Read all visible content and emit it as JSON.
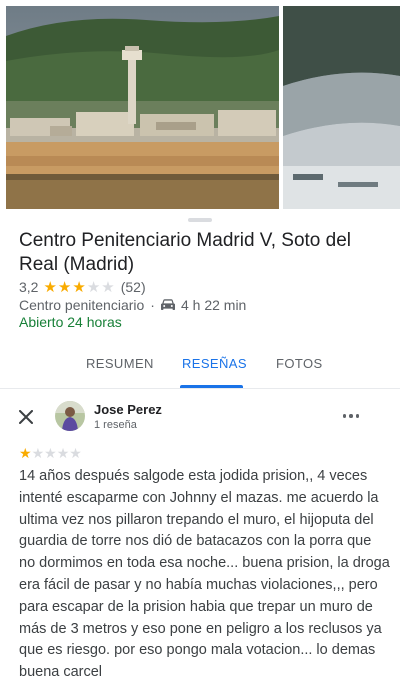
{
  "place": {
    "name": "Centro Penitenciario Madrid V, Soto del Real (Madrid)",
    "rating": "3,2",
    "rating_value": 3.2,
    "stars_filled": 3,
    "stars_total": 5,
    "review_count": "(52)",
    "category": "Centro penitenciario",
    "separator": "·",
    "drive_time": "4 h 22 min",
    "hours": "Abierto 24 horas"
  },
  "tabs": [
    {
      "label": "RESUMEN",
      "active": false
    },
    {
      "label": "RESEÑAS",
      "active": true
    },
    {
      "label": "FOTOS",
      "active": false
    }
  ],
  "review": {
    "author": "Jose Perez",
    "author_reviews": "1 reseña",
    "stars_filled": 1,
    "stars_total": 5,
    "text": "14 años después salgode esta jodida prision,, 4 veces intenté escaparme con Johnny el mazas. me acuerdo la ultima vez nos pillaron trepando el muro, el hijoputa del guardia de torre nos dió de batacazos con la porra que no dormimos en toda esa noche... buena prision, la droga era fácil de pasar y no había muchas violaciones,,, pero para escapar de la prision habia que trepar un muro de más de 3 metros y eso pone en peligro a los reclusos ya que es riesgo.  por eso pongo mala votacion... lo demas buena carcel"
  },
  "icons": {
    "drive": "car-icon",
    "close": "close-icon",
    "more": "more-vert-icon",
    "star": "star-icon"
  },
  "colors": {
    "accent": "#1a73e8",
    "star_on": "#f9ab00",
    "star_off": "#dadce0",
    "open_green": "#188038",
    "secondary_text": "#5f6368"
  }
}
